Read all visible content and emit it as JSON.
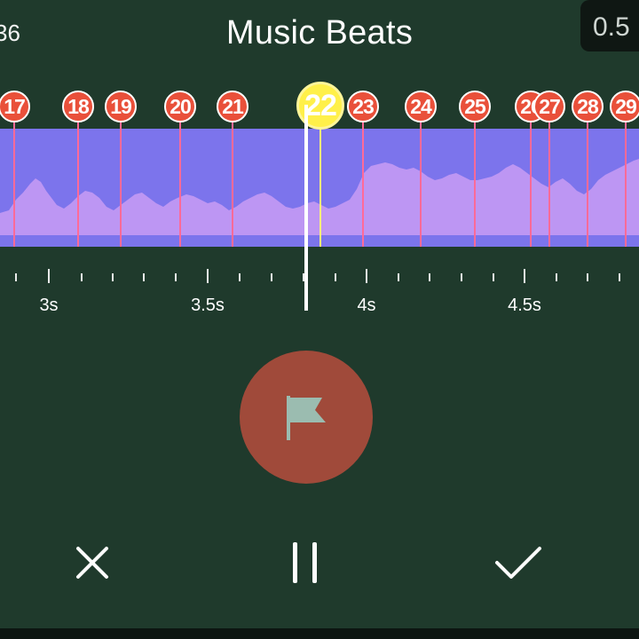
{
  "header": {
    "title": "Music Beats",
    "left_clipped_text": "36",
    "right_clipped_text": "0.5"
  },
  "beats": [
    {
      "label": "17",
      "active": false
    },
    {
      "label": "18",
      "active": false
    },
    {
      "label": "19",
      "active": false
    },
    {
      "label": "20",
      "active": false
    },
    {
      "label": "21",
      "active": false
    },
    {
      "label": "22",
      "active": true
    },
    {
      "label": "23",
      "active": false
    },
    {
      "label": "24",
      "active": false
    },
    {
      "label": "25",
      "active": false
    },
    {
      "label": "26",
      "active": false
    },
    {
      "label": "27",
      "active": false
    },
    {
      "label": "28",
      "active": false
    },
    {
      "label": "29",
      "active": false
    }
  ],
  "timeline": {
    "labels": [
      "3s",
      "3.5s",
      "4s",
      "4.5s"
    ]
  },
  "controls": {
    "cancel": "close-icon",
    "pause": "pause-icon",
    "confirm": "check-icon",
    "flag": "flag-icon"
  },
  "colors": {
    "background": "#1f3a2c",
    "waveform_track": "#7c74ec",
    "waveform_fill": "#c99cf5",
    "beat_marker": "#e9503a",
    "active_beat": "#fff04a",
    "beat_line": "#ff6a98",
    "flag_button": "#a04a3a"
  }
}
